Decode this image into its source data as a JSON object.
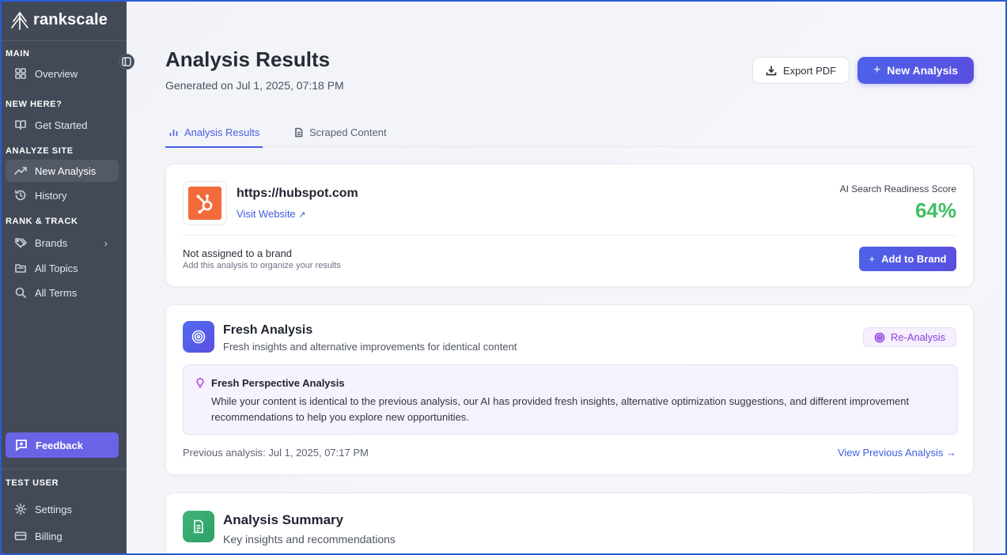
{
  "brand": {
    "name": "rankscale"
  },
  "sidebar": {
    "sections": {
      "main": "MAIN",
      "new_here": "NEW HERE?",
      "analyze_site": "ANALYZE SITE",
      "rank_track": "RANK & TRACK",
      "user": "TEST USER"
    },
    "items": {
      "overview": "Overview",
      "get_started": "Get Started",
      "new_analysis": "New Analysis",
      "history": "History",
      "brands": "Brands",
      "all_topics": "All Topics",
      "all_terms": "All Terms",
      "settings": "Settings",
      "billing": "Billing"
    },
    "feedback": "Feedback",
    "active": "new_analysis"
  },
  "header": {
    "title": "Analysis Results",
    "subtitle": "Generated on Jul 1, 2025, 07:18 PM",
    "export_label": "Export PDF",
    "new_analysis_label": "New Analysis"
  },
  "tabs": [
    {
      "label": "Analysis Results",
      "active": true
    },
    {
      "label": "Scraped Content",
      "active": false
    }
  ],
  "site_card": {
    "url": "https://hubspot.com",
    "visit_label": "Visit Website",
    "score_label": "AI Search Readiness Score",
    "score_value": "64%",
    "score_color": "#3fbf62",
    "brand_status": "Not assigned to a brand",
    "brand_hint": "Add this analysis to organize your results",
    "add_brand_label": "Add to Brand"
  },
  "fresh_card": {
    "title": "Fresh Analysis",
    "subtitle": "Fresh insights and alternative improvements for identical content",
    "badge": "Re-Analysis",
    "perspective_title": "Fresh Perspective Analysis",
    "perspective_body": "While your content is identical to the previous analysis, our AI has provided fresh insights, alternative optimization suggestions, and different improvement recommendations to help you explore new opportunities.",
    "previous_text": "Previous analysis: Jul 1, 2025, 07:17 PM",
    "previous_link": "View Previous Analysis →"
  },
  "summary_card": {
    "title": "Analysis Summary",
    "subtitle": "Key insights and recommendations"
  },
  "colors": {
    "sidebar_bg": "#434a57",
    "accent": "#4a5ee0",
    "feedback": "#6b63e6",
    "hubspot": "#f26b3a",
    "reanalysis": "#8b3fdc"
  }
}
